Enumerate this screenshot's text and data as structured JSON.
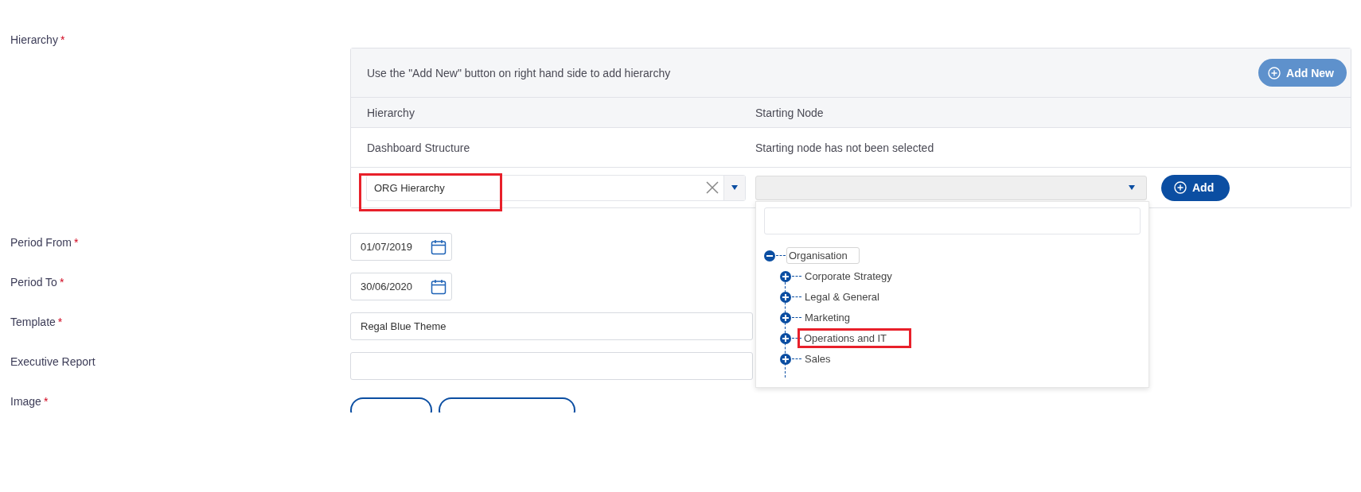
{
  "hierarchy_field": {
    "label": "Hierarchy",
    "mark": "*"
  },
  "hierarchy_table": {
    "hint": "Use the \"Add New\" button on right hand side to add hierarchy",
    "add_new_button": "Add New",
    "columns": [
      "Hierarchy",
      "Starting Node"
    ],
    "rows": [
      {
        "hierarchy": "Dashboard Structure",
        "starting_node": "Starting node has not been selected"
      }
    ],
    "new_row": {
      "hierarchy_select": {
        "value": "ORG Hierarchy",
        "highlighted": true
      },
      "node_select": {
        "expanded": true
      },
      "add_button": "Add"
    },
    "node_dropdown": {
      "tree": [
        {
          "label": "Organisation",
          "expanded": true,
          "focused": true,
          "highlighted": false,
          "children": [
            {
              "label": "Corporate Strategy",
              "expanded": false,
              "focused": false,
              "highlighted": false
            },
            {
              "label": "Legal & General",
              "expanded": false,
              "focused": false,
              "highlighted": false
            },
            {
              "label": "Marketing",
              "expanded": false,
              "focused": false,
              "highlighted": false
            },
            {
              "label": "Operations and IT",
              "expanded": false,
              "focused": false,
              "highlighted": true
            },
            {
              "label": "Sales",
              "expanded": false,
              "focused": false,
              "highlighted": false
            }
          ]
        }
      ]
    }
  },
  "fields": [
    {
      "kind": "date",
      "label": "Period From",
      "mark": "*",
      "value": "01/07/2019"
    },
    {
      "kind": "date",
      "label": "Period To",
      "mark": "*",
      "value": "30/06/2020"
    },
    {
      "kind": "text",
      "label": "Template",
      "mark": "*",
      "value": "Regal Blue Theme"
    },
    {
      "kind": "text",
      "label": "Executive Report"
    },
    {
      "kind": "buttons",
      "label": "Image",
      "mark": "*",
      "buttons": [
        {
          "kind": "outline"
        },
        {
          "kind": "outline"
        }
      ]
    }
  ]
}
